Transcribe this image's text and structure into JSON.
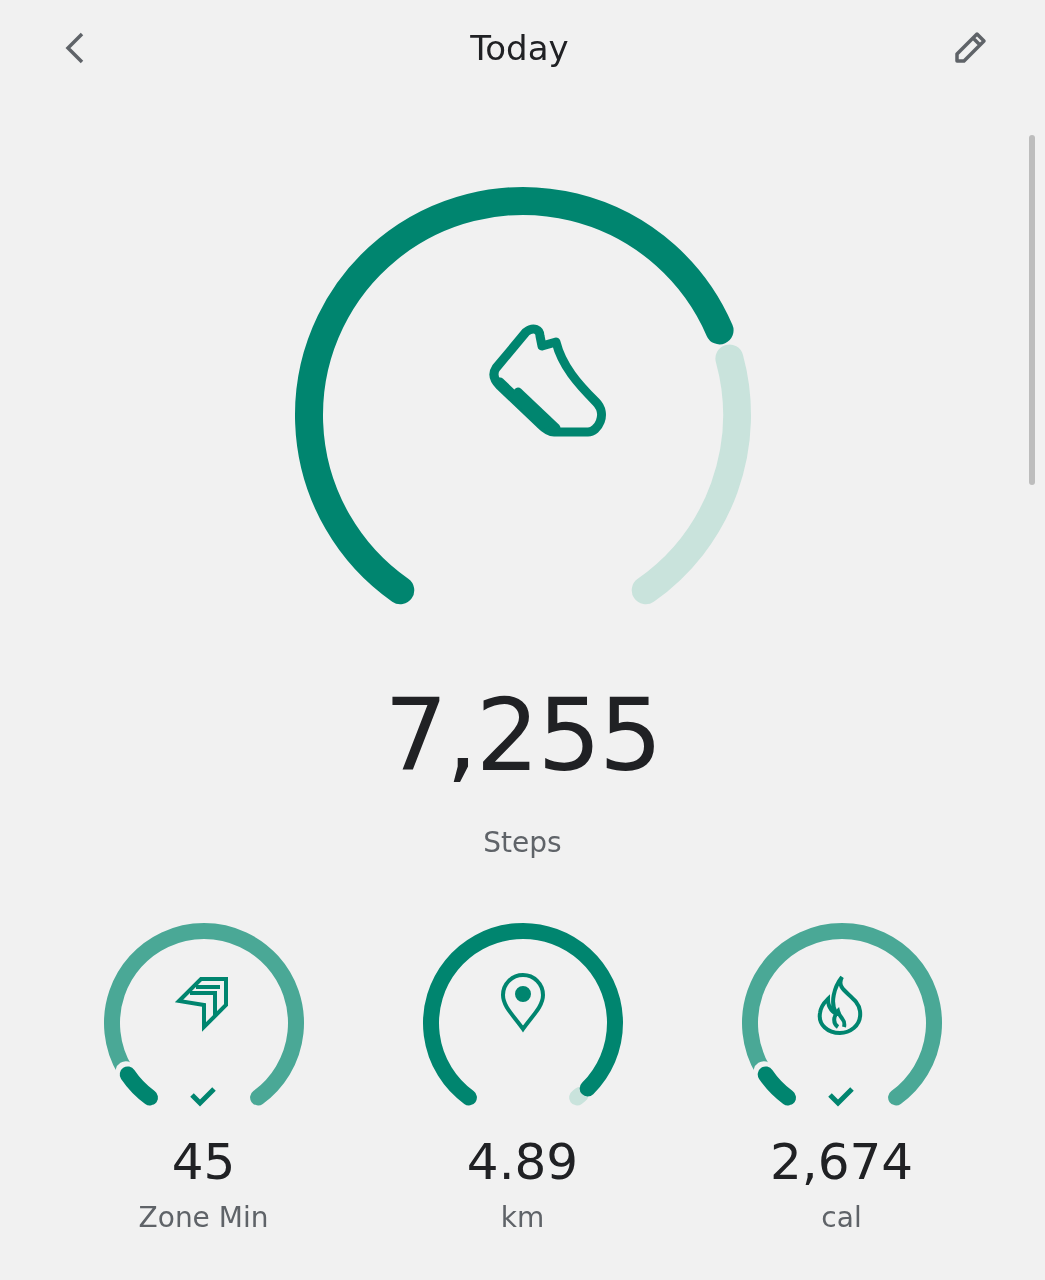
{
  "header": {
    "title": "Today"
  },
  "main_metric": {
    "value": "7,255",
    "label": "Steps"
  },
  "metrics": [
    {
      "kind": "zone",
      "value": "45",
      "label": "Zone Min",
      "goal_met": true
    },
    {
      "kind": "distance",
      "value": "4.89",
      "label": "km",
      "goal_met": false
    },
    {
      "kind": "calories",
      "value": "2,674",
      "label": "cal",
      "goal_met": true
    }
  ]
}
